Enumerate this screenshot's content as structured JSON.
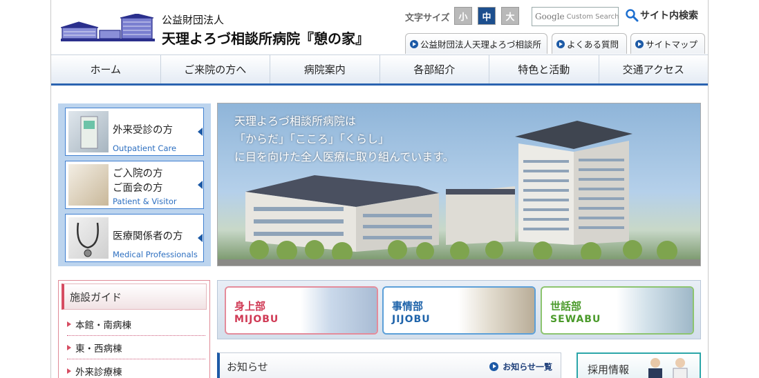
{
  "header": {
    "corp_label": "公益財団法人",
    "hospital_name": "天理よろづ相談所病院『憩の家』",
    "font_size": {
      "label": "文字サイズ",
      "small": "小",
      "medium": "中",
      "large": "大",
      "selected": "中"
    },
    "search": {
      "brand": "Google",
      "placeholder": "Custom Search",
      "link_label": "サイト内検索"
    },
    "sub_tabs": [
      "公益財団法人天理よろづ相談所",
      "よくある質問",
      "サイトマップ"
    ]
  },
  "nav": [
    "ホーム",
    "ご来院の方へ",
    "病院案内",
    "各部紹介",
    "特色と活動",
    "交通アクセス"
  ],
  "services": [
    {
      "jp": [
        "外来受診の方"
      ],
      "en": "Outpatient Care"
    },
    {
      "jp": [
        "ご入院の方",
        "ご面会の方"
      ],
      "en": "Patient & Visitor"
    },
    {
      "jp": [
        "医療関係者の方"
      ],
      "en": "Medical Professionals"
    }
  ],
  "hero": {
    "lines": [
      "天理よろづ相談所病院は",
      "「からだ」「こころ」「くらし」",
      "に目を向けた全人医療に取り組んでいます。"
    ]
  },
  "guide": {
    "title": "施設ガイド",
    "items": [
      "本館・南病棟",
      "東・西病棟",
      "外来診療棟"
    ]
  },
  "departments": [
    {
      "jp": "身上部",
      "en": "MIJOBU",
      "color": "#d03a55"
    },
    {
      "jp": "事情部",
      "en": "JIJOBU",
      "color": "#1e63aa"
    },
    {
      "jp": "世話部",
      "en": "SEWABU",
      "color": "#4a9a2a"
    }
  ],
  "news": {
    "title": "お知らせ",
    "more_label": "お知らせ一覧"
  },
  "recruit": {
    "label": "採用情報"
  },
  "colors": {
    "accent": "#1d5aa6",
    "guide_accent": "#d64d62"
  }
}
